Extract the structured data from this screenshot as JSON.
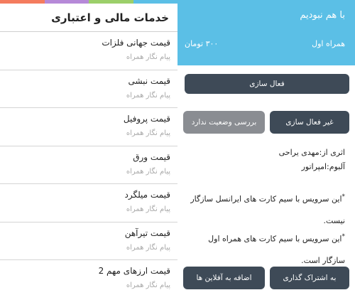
{
  "colors": {
    "strip": [
      "#f47c5e",
      "#b689d8",
      "#9ccf6a",
      "#5bbfe6"
    ],
    "header_blue": "#5bbfe6",
    "button_dark": "#3e4a57",
    "button_gray": "#8a8d92"
  },
  "services": {
    "title": "خدمات مالی و اعتباری",
    "items": [
      {
        "name": "قیمت جهانی فلزات",
        "provider": "پیام نگار همراه"
      },
      {
        "name": "قیمت نبشی",
        "provider": "پیام نگار همراه"
      },
      {
        "name": "قیمت پروفیل",
        "provider": "پیام نگار همراه"
      },
      {
        "name": "قیمت ورق",
        "provider": "پیام نگار همراه"
      },
      {
        "name": "قیمت میلگرد",
        "provider": "پیام نگار همراه"
      },
      {
        "name": "قیمت تیرآهن",
        "provider": "پیام نگار همراه"
      },
      {
        "name": "قیمت ارزهای مهم 2",
        "provider": "پیام نگار همراه"
      }
    ]
  },
  "detail": {
    "welcome": "با هم نبودیم",
    "operator": "همراه اول",
    "price": "۳۰۰ تومان",
    "activate_label": "فعال سازی",
    "deactivate_label": "غیر فعال سازی",
    "status_label": "بررسی وضعیت ندارد",
    "artist": "اثری از:مهدی یراحی",
    "album": "آلبوم:امپراتور",
    "note_star": "*",
    "note1": "این سرویس با سیم کارت های ایرانسل سازگار نیست.",
    "note2": "این سرویس با سیم کارت های همراه اول سازگار است.",
    "subscribe_label": "به اشتراک گذاری",
    "add_playlist_label": "اضافه به آفلاین ها"
  }
}
